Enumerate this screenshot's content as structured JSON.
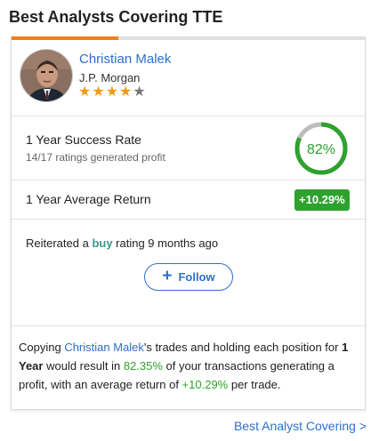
{
  "widget": {
    "title": "Best Analysts Covering TTE"
  },
  "analyst": {
    "name": "Christian Malek",
    "firm": "J.P. Morgan",
    "rating_stars": 4,
    "rating_max": 5
  },
  "success_rate": {
    "label": "1 Year Success Rate",
    "sub": "14/17 ratings generated profit",
    "value_text": "82%",
    "value_fraction": 0.82
  },
  "average_return": {
    "label": "1 Year Average Return",
    "value": "+10.29%"
  },
  "reiterated": {
    "prefix": "Reiterated a ",
    "rating": "buy",
    "suffix": " rating 9 months ago"
  },
  "follow_button": {
    "label": "Follow"
  },
  "copy": {
    "part1": "Copying ",
    "name": "Christian Malek",
    "part2": "'s trades and holding each position for ",
    "period": "1 Year",
    "part3": " would result in ",
    "pct": "82.35%",
    "part4": " of your transactions generating a profit, with an average return of ",
    "ret": "+10.29%",
    "part5": " per trade."
  },
  "footer": {
    "link": "Best Analyst Covering >"
  },
  "colors": {
    "accent_orange": "#ef7f1a",
    "link_blue": "#2f6fc9",
    "positive_green": "#2ea12e",
    "buy_teal": "#3a9a8e",
    "star_gold": "#ef9a1a"
  }
}
